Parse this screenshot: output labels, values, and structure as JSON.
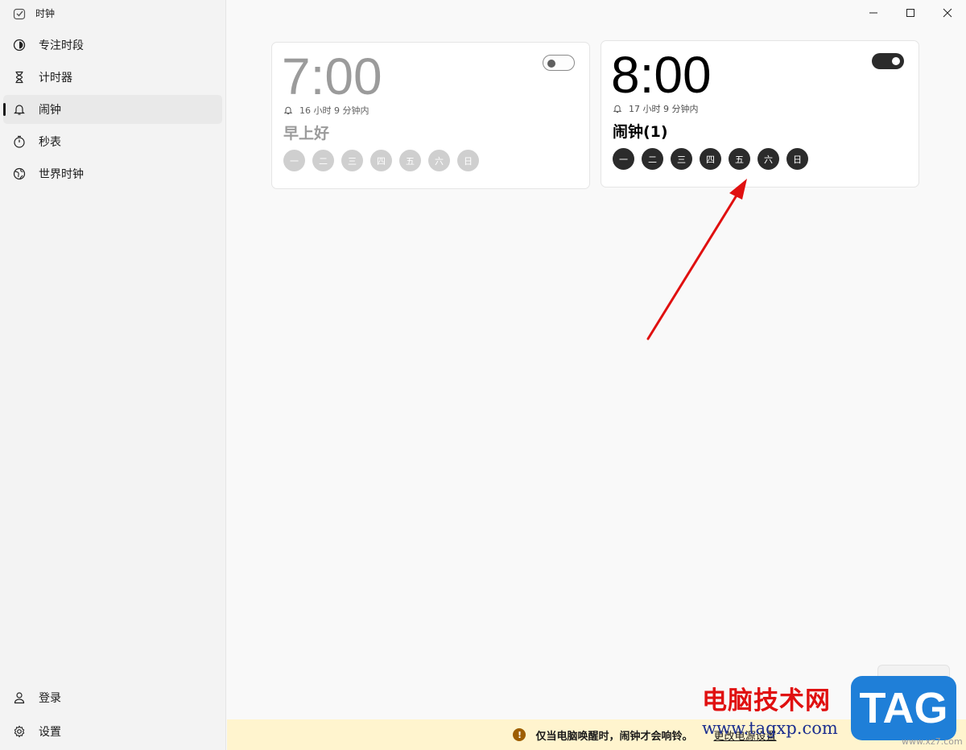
{
  "app": {
    "title": "时钟"
  },
  "sidebar": {
    "items": [
      {
        "label": "专注时段",
        "icon": "focus-icon"
      },
      {
        "label": "计时器",
        "icon": "hourglass-icon"
      },
      {
        "label": "闹钟",
        "icon": "bell-icon",
        "active": true
      },
      {
        "label": "秒表",
        "icon": "stopwatch-icon"
      },
      {
        "label": "世界时钟",
        "icon": "globe-icon"
      }
    ],
    "bottom": [
      {
        "label": "登录",
        "icon": "person-icon"
      },
      {
        "label": "设置",
        "icon": "gear-icon"
      }
    ]
  },
  "alarms": [
    {
      "time": "7:00",
      "remaining": "16 小时 9 分钟内",
      "name": "早上好",
      "enabled": false,
      "days": [
        "一",
        "二",
        "三",
        "四",
        "五",
        "六",
        "日"
      ]
    },
    {
      "time": "8:00",
      "remaining": "17 小时 9 分钟内",
      "name": "闹钟(1)",
      "enabled": true,
      "days": [
        "一",
        "二",
        "三",
        "四",
        "五",
        "六",
        "日"
      ]
    }
  ],
  "info_bar": {
    "message": "仅当电脑唤醒时，闹钟才会响铃。",
    "link": "更改电源设置",
    "warn_glyph": "!"
  },
  "watermark": {
    "site_name": "电脑技术网",
    "url": "www.tagxp.com",
    "logo": "TAG",
    "small": "www.xz7.com"
  },
  "colors": {
    "accent_dark": "#2b2b2b",
    "disabled_gray": "#cfcfcf",
    "info_bg": "#fff4ce",
    "arrow_red": "#e01010"
  }
}
